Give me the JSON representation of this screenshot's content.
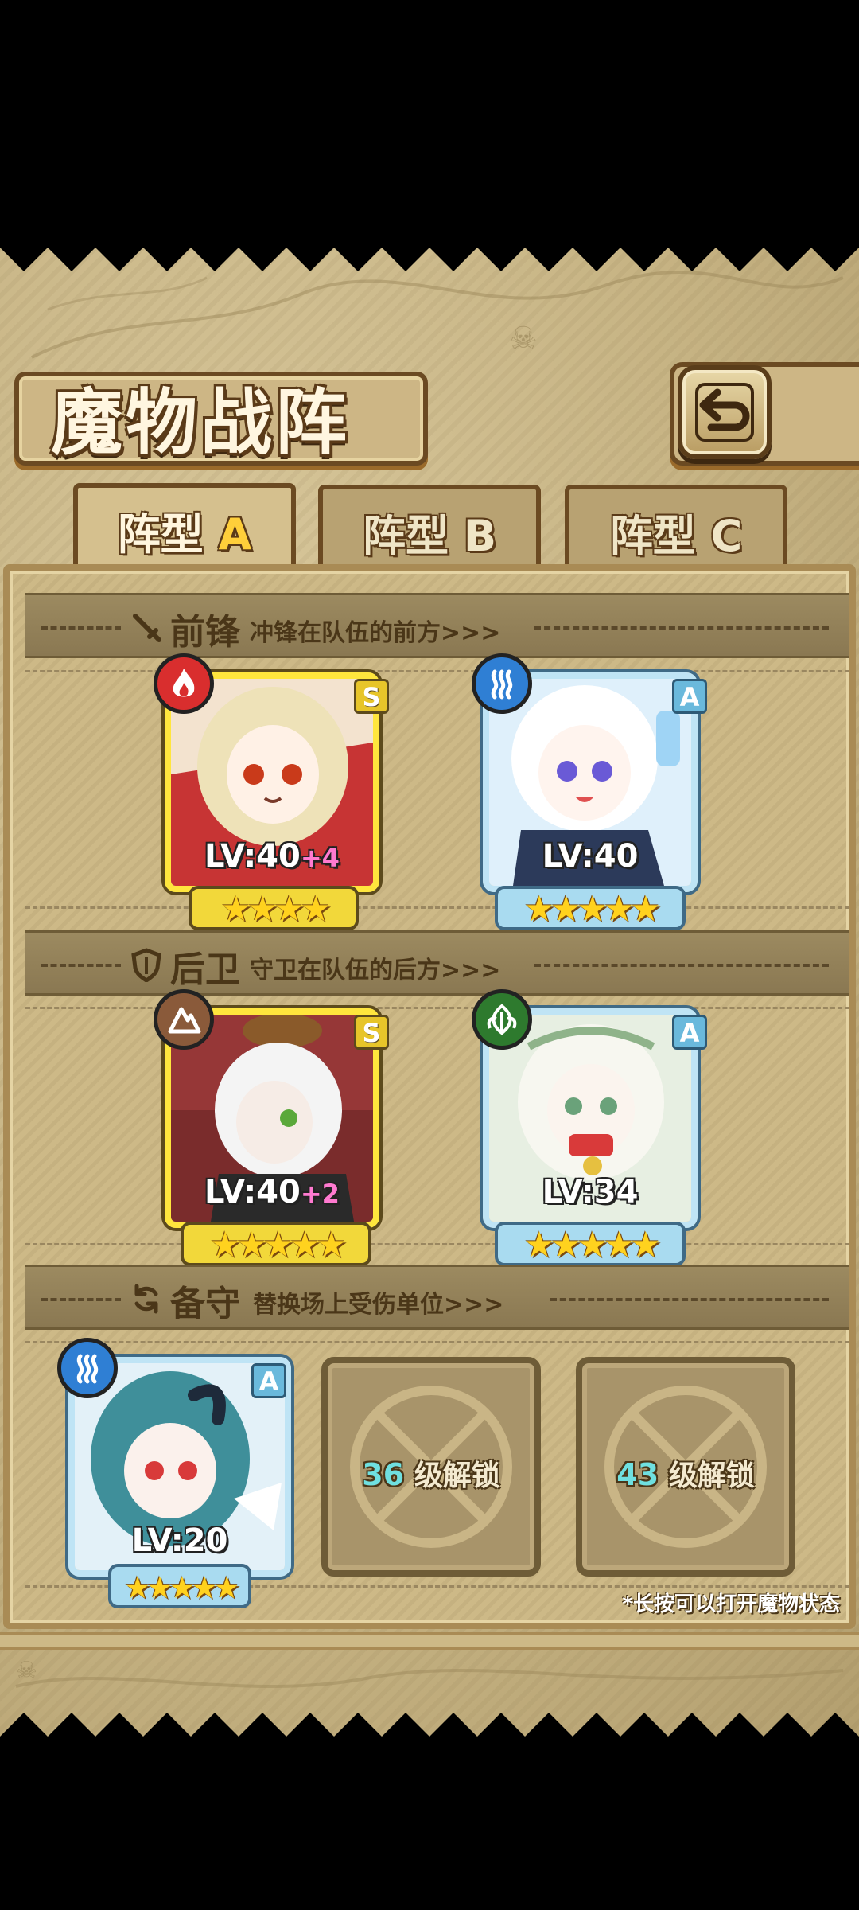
{
  "header": {
    "title": "魔物战阵"
  },
  "tabs": [
    {
      "label": "阵型",
      "letter": "A",
      "active": true
    },
    {
      "label": "阵型",
      "letter": "B",
      "active": false
    },
    {
      "label": "阵型",
      "letter": "C",
      "active": false
    }
  ],
  "sections": {
    "front": {
      "icon": "sword-icon",
      "title": "前锋",
      "subtitle": "冲锋在队伍的前方>>>"
    },
    "rear": {
      "icon": "shield-icon",
      "title": "后卫",
      "subtitle": "守卫在队伍的后方>>>"
    },
    "reserve": {
      "icon": "swap-icon",
      "title": "备守",
      "subtitle": "替换场上受伤单位>>>"
    }
  },
  "front_units": [
    {
      "element": "fire-icon",
      "element_color": "#d92e2e",
      "rank": "S",
      "level_text": "LV:40",
      "bonus": "+4",
      "stars": "★★★★",
      "star_count": 4,
      "frame": "gold"
    },
    {
      "element": "water-icon",
      "element_color": "#2f7fd4",
      "rank": "A",
      "level_text": "LV:40",
      "bonus": "",
      "stars": "★★★★★",
      "star_count": 5,
      "frame": "blue"
    }
  ],
  "rear_units": [
    {
      "element": "earth-icon",
      "element_color": "#8a5a3a",
      "rank": "S",
      "level_text": "LV:40",
      "bonus": "+2",
      "stars": "★★★★★",
      "star_count": 5,
      "frame": "gold"
    },
    {
      "element": "leaf-icon",
      "element_color": "#2e7a2e",
      "rank": "A",
      "level_text": "LV:34",
      "bonus": "",
      "stars": "★★★★★",
      "star_count": 5,
      "frame": "blue"
    }
  ],
  "reserve_units": [
    {
      "element": "water-icon",
      "element_color": "#2f7fd4",
      "rank": "A",
      "level_text": "LV:20",
      "bonus": "",
      "stars": "★★★★★",
      "star_count": 5,
      "frame": "blue"
    }
  ],
  "locked_slots": [
    {
      "level": "36",
      "text": "级解锁"
    },
    {
      "level": "43",
      "text": "级解锁"
    }
  ],
  "footnote": "*长按可以打开魔物状态",
  "colors": {
    "panel": "#c6b383",
    "border": "#6b4a22",
    "accent_gold": "#ffcf3a",
    "unlock_level": "#6fe0e0",
    "bonus": "#ff7ad0"
  }
}
